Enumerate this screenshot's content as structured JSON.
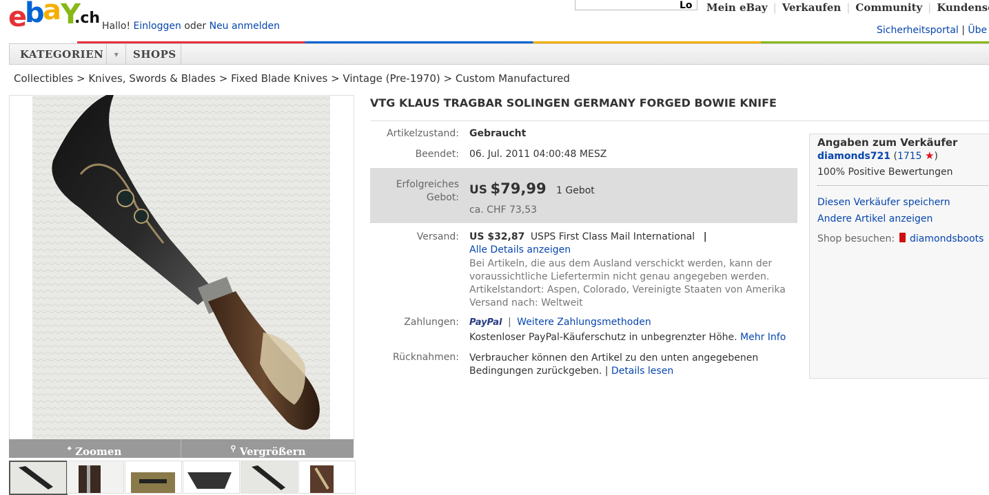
{
  "header": {
    "logo_letters": [
      "e",
      "b",
      "a",
      "Y"
    ],
    "logo_suffix": ".ch",
    "greeting": "Hallo!",
    "login_link": "Einloggen",
    "or_text": "oder",
    "register_link": "Neu anmelden",
    "search_button": "Lo",
    "nav": [
      "Mein eBay",
      "Verkaufen",
      "Community",
      "Kundenserv"
    ],
    "security_portal": "Sicherheitsportal",
    "security_sep": "|",
    "overflow_link": "Übe"
  },
  "catbar": {
    "categories": "KATEGORIEN",
    "dropdown_glyph": "▾",
    "shops": "SHOPS"
  },
  "breadcrumb": "Collectibles > Knives, Swords & Blades > Fixed Blade Knives > Vintage (Pre-1970) > Custom Manufactured",
  "item": {
    "title": "VTG KLAUS TRAGBAR SOLINGEN GERMANY FORGED BOWIE KNIFE",
    "condition_label": "Artikelzustand:",
    "condition": "Gebraucht",
    "ended_label": "Beendet:",
    "ended": "06. Jul. 2011 04:00:48 MESZ",
    "bid_label_1": "Erfolgreiches",
    "bid_label_2": "Gebot:",
    "currency": "US",
    "price": "$79,99",
    "bids": "1 Gebot",
    "price_chf": "ca. CHF 73,53",
    "shipping_label": "Versand:",
    "shipping_price": "US $32,87",
    "shipping_method": "USPS First Class Mail International",
    "shipping_sep": "|",
    "shipping_details": "Alle Details anzeigen",
    "shipping_note_1": "Bei Artikeln, die aus dem Ausland verschickt werden, kann der",
    "shipping_note_2": "voraussichtliche Liefertermin nicht genau angegeben werden.",
    "location": "Artikelstandort: Aspen, Colorado, Vereinigte Staaten von Amerika",
    "ships_to": "Versand nach: Weltweit",
    "payment_label": "Zahlungen:",
    "paypal": "PayPal",
    "payment_sep": "|",
    "payment_more": "Weitere Zahlungsmethoden",
    "buyer_protection": "Kostenloser PayPal-Käuferschutz in unbegrenzter Höhe.",
    "more_info": "Mehr Info",
    "returns_label": "Rücknahmen:",
    "returns_1": "Verbraucher können den Artikel zu den unten angegebenen",
    "returns_2": "Bedingungen zurückgeben. |",
    "returns_link": "Details lesen"
  },
  "gallery": {
    "zoom": "Zoomen",
    "enlarge": "Vergrößern",
    "thumb_count": 6
  },
  "seller": {
    "heading": "Angaben zum Verkäufer",
    "name": "diamonds721",
    "feedback_open": "(",
    "feedback": "1715",
    "feedback_close": ")",
    "positive": "100% Positive Bewertungen",
    "save": "Diesen Verkäufer speichern",
    "other_items": "Andere Artikel anzeigen",
    "shop_label": "Shop besuchen:",
    "shop": "diamondsboots"
  },
  "colors": {
    "link": "#0645ad",
    "logo_e": "#e53238",
    "logo_b": "#0064d2",
    "logo_a": "#f5af02",
    "logo_y": "#86b817",
    "paypal_dark": "#253b80",
    "paypal_light": "#179bd7",
    "star": "#e0101a"
  }
}
